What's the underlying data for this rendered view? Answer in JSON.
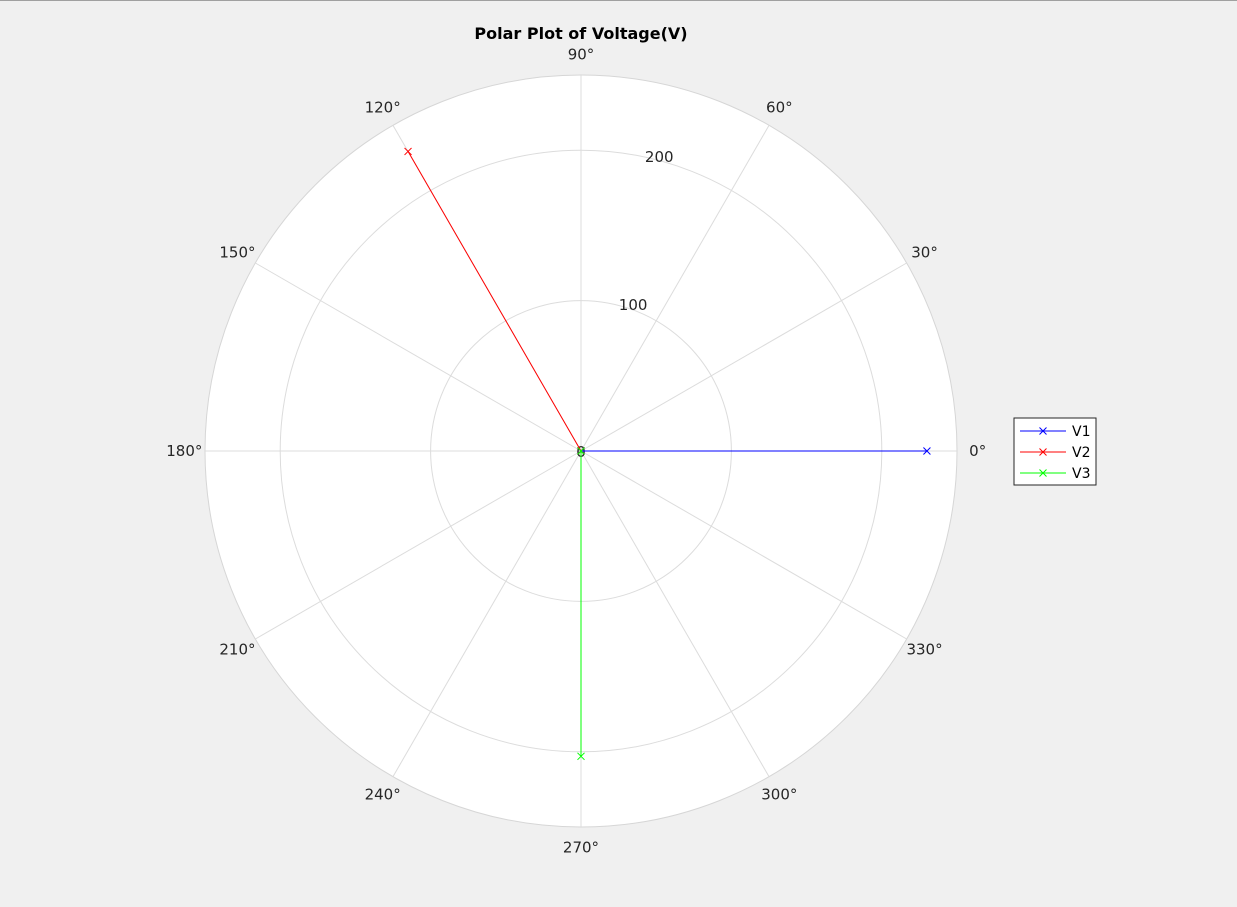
{
  "chart_data": {
    "type": "polar",
    "title": "Polar Plot of Voltage(V)",
    "theta_ticks": [
      0,
      30,
      60,
      90,
      120,
      150,
      180,
      210,
      240,
      270,
      300,
      330
    ],
    "theta_tick_labels": [
      "0°",
      "30°",
      "60°",
      "90°",
      "120°",
      "150°",
      "180°",
      "210°",
      "240°",
      "270°",
      "300°",
      "330°"
    ],
    "r_ticks": [
      0,
      100,
      200
    ],
    "r_tick_labels": [
      "0",
      "100",
      "200"
    ],
    "rlim": [
      0,
      250
    ],
    "grid": true,
    "legend_position": "right",
    "series": [
      {
        "name": "V1",
        "color": "#0000ff",
        "marker": "x",
        "theta": [
          0,
          0
        ],
        "r": [
          0,
          230
        ]
      },
      {
        "name": "V2",
        "color": "#ff0000",
        "marker": "x",
        "theta": [
          0,
          120
        ],
        "r": [
          0,
          230
        ]
      },
      {
        "name": "V3",
        "color": "#00ff00",
        "marker": "x",
        "theta": [
          0,
          270
        ],
        "r": [
          0,
          203
        ]
      }
    ]
  }
}
